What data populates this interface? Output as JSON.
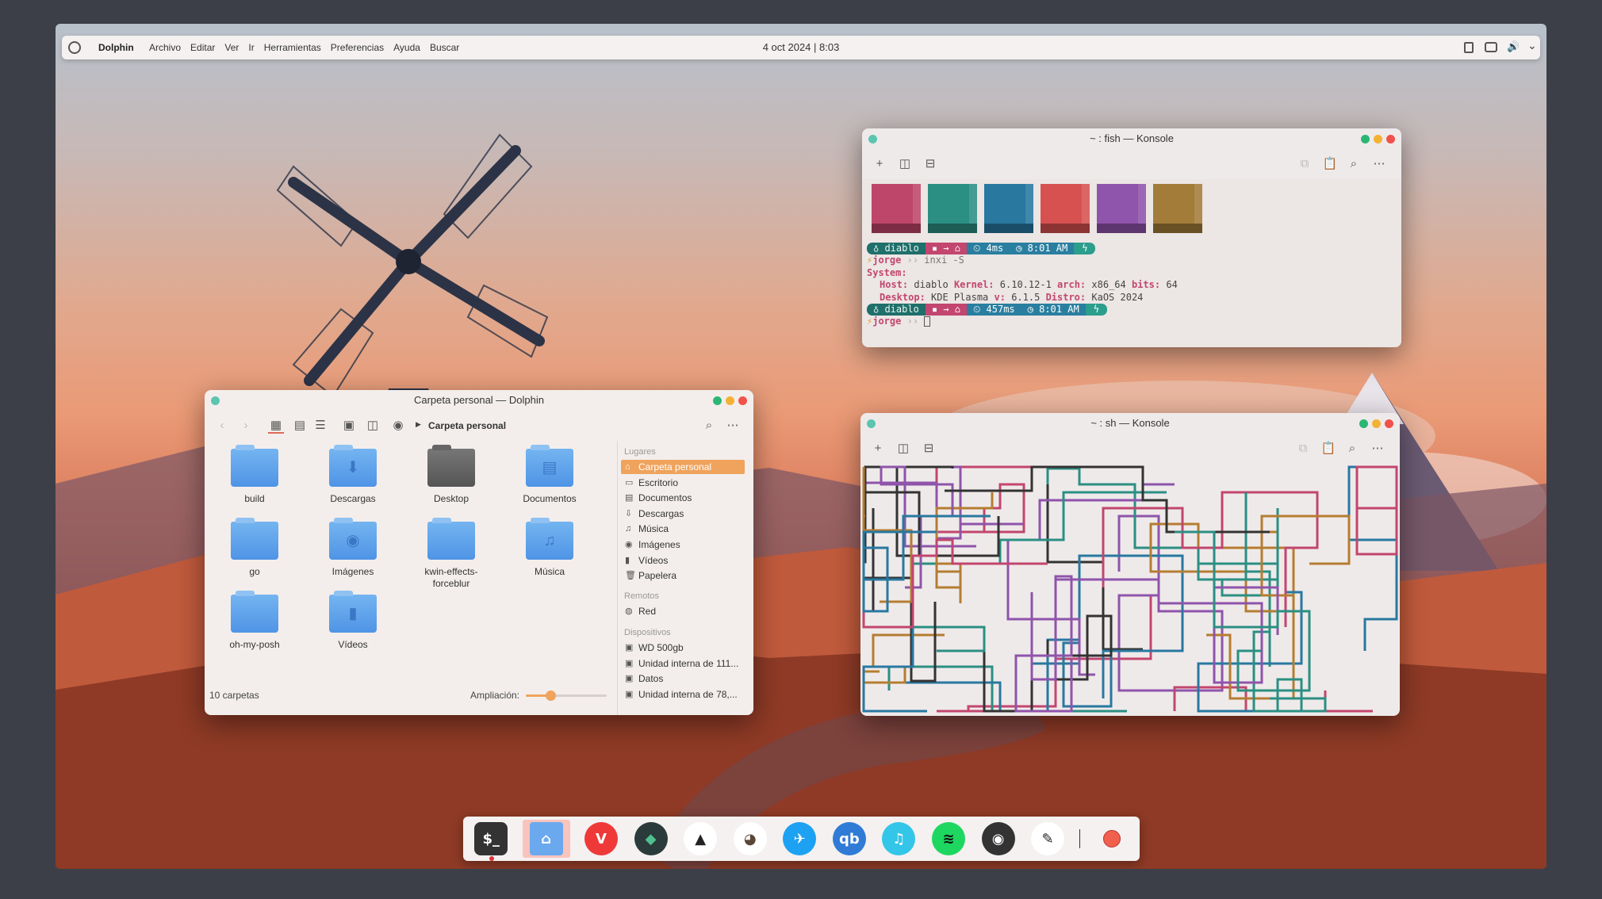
{
  "panel": {
    "app_name": "Dolphin",
    "menu": [
      "Archivo",
      "Editar",
      "Ver",
      "Ir",
      "Herramientas",
      "Preferencias",
      "Ayuda",
      "Buscar"
    ],
    "clock": "4 oct 2024 | 8:03"
  },
  "dolphin": {
    "title": "Carpeta personal — Dolphin",
    "breadcrumb": "Carpeta personal",
    "status": "10 carpetas",
    "zoom_label": "Ampliación:",
    "zoom_level": 0.3,
    "folders": [
      {
        "name": "build",
        "icon": "folder-icon"
      },
      {
        "name": "Descargas",
        "icon": "folder-download-icon"
      },
      {
        "name": "Desktop",
        "icon": "folder-desktop-icon"
      },
      {
        "name": "Documentos",
        "icon": "folder-documents-icon"
      },
      {
        "name": "go",
        "icon": "folder-icon"
      },
      {
        "name": "Imágenes",
        "icon": "folder-pictures-icon"
      },
      {
        "name": "kwin-effects-forceblur",
        "icon": "folder-icon"
      },
      {
        "name": "Música",
        "icon": "folder-music-icon"
      },
      {
        "name": "oh-my-posh",
        "icon": "folder-icon"
      },
      {
        "name": "Vídeos",
        "icon": "folder-videos-icon"
      }
    ],
    "places_header": "Lugares",
    "places": [
      "Carpeta personal",
      "Escritorio",
      "Documentos",
      "Descargas",
      "Música",
      "Imágenes",
      "Vídeos",
      "Papelera"
    ],
    "remote_header": "Remotos",
    "remote": [
      "Red"
    ],
    "devices_header": "Dispositivos",
    "devices": [
      "WD 500gb",
      "Unidad interna de 111...",
      "Datos",
      "Unidad interna de 78,..."
    ]
  },
  "konsole1": {
    "title": "~ : fish — Konsole",
    "swatches": [
      "#bf466b",
      "#2b8f83",
      "#2878a0",
      "#d75150",
      "#8f54ab",
      "#a37c3a"
    ],
    "prompt1": {
      "host": "diablo",
      "time_taken": "4ms",
      "clock": "8:01 AM"
    },
    "user": "jorge",
    "command": "inxi -S",
    "out_system": "System:",
    "out_host_label": "Host:",
    "out_host": "diablo",
    "out_kernel_label": "Kernel:",
    "out_kernel": "6.10.12-1",
    "out_arch_label": "arch:",
    "out_arch": "x86_64",
    "out_bits_label": "bits:",
    "out_bits": "64",
    "out_desktop_label": "Desktop:",
    "out_desktop": "KDE Plasma",
    "out_v_label": "v:",
    "out_v": "6.1.5",
    "out_distro_label": "Distro:",
    "out_distro": "KaOS 2024",
    "prompt2": {
      "host": "diablo",
      "time_taken": "457ms",
      "clock": "8:01 AM"
    }
  },
  "konsole2": {
    "title": "~ : sh — Konsole"
  },
  "dock": [
    "terminal",
    "dolphin-file-manager",
    "vivaldi",
    "keepassxc",
    "inkscape",
    "gimp",
    "kdeconnect",
    "qbittorrent",
    "music-player",
    "spotify",
    "steam",
    "color-picker",
    "screen-recorder"
  ],
  "colors": {
    "accent": "#f0a35c",
    "panel_bg": "#f4f1f0"
  }
}
